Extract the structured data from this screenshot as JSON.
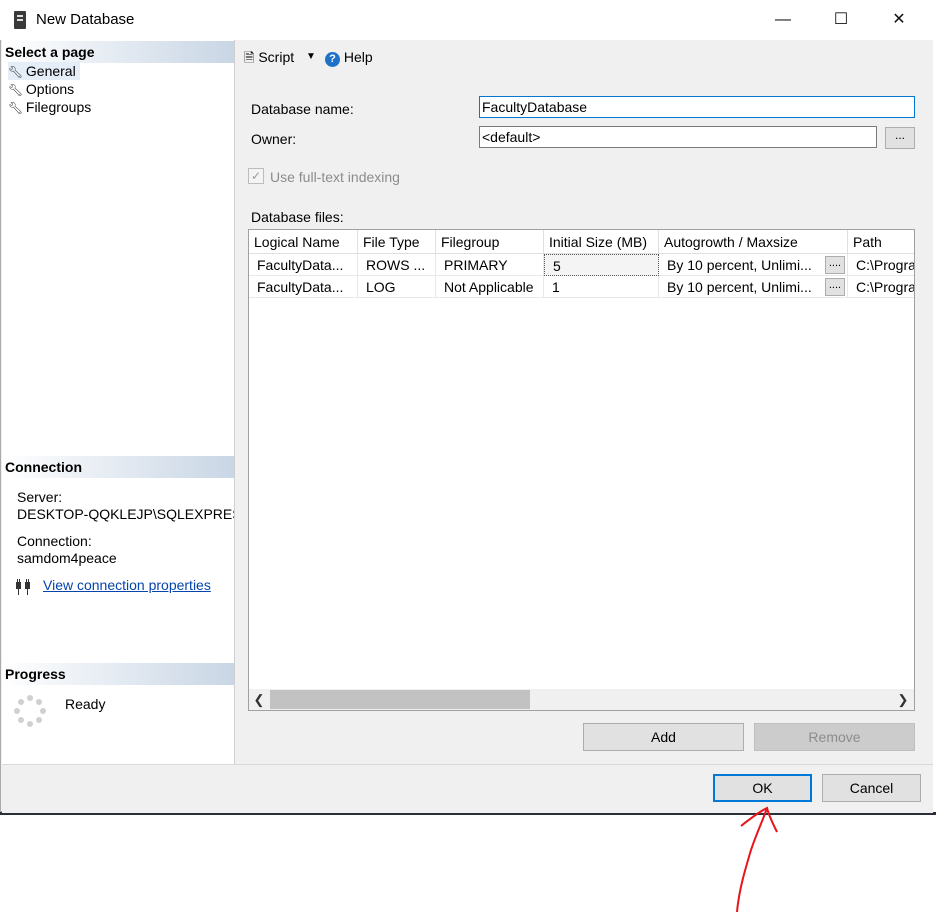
{
  "window": {
    "title": "New Database",
    "minimize_glyph": "—",
    "maximize_glyph": "☐",
    "close_glyph": "✕"
  },
  "left_pane": {
    "select_page_header": "Select a page",
    "pages": [
      {
        "label": "General",
        "icon": "wrench-icon",
        "selected": true
      },
      {
        "label": "Options",
        "icon": "wrench-icon",
        "selected": false
      },
      {
        "label": "Filegroups",
        "icon": "wrench-icon",
        "selected": false
      }
    ],
    "connection_header": "Connection",
    "server_label": "Server:",
    "server_value": "DESKTOP-QQKLEJP\\SQLEXPRESS",
    "connection_label": "Connection:",
    "connection_value": "samdom4peace",
    "view_connection_link": "View connection properties",
    "progress_header": "Progress",
    "progress_status": "Ready"
  },
  "toolbar": {
    "script_label": "Script",
    "help_label": "Help"
  },
  "general": {
    "database_name_label": "Database name:",
    "database_name_value": "FacultyDatabase",
    "owner_label": "Owner:",
    "owner_value": "<default>",
    "browse_glyph": "...",
    "fulltext_label": "Use full-text indexing",
    "fulltext_checked": true,
    "database_files_label": "Database files:"
  },
  "files_grid": {
    "columns": [
      "Logical Name",
      "File Type",
      "Filegroup",
      "Initial Size (MB)",
      "Autogrowth / Maxsize",
      "Path"
    ],
    "rows": [
      [
        "FacultyData...",
        "ROWS ...",
        "PRIMARY",
        "5",
        "By 10 percent, Unlimi...",
        "C:\\Progra"
      ],
      [
        "FacultyData...",
        "LOG",
        "Not Applicable",
        "1",
        "By 10 percent, Unlimi...",
        "C:\\Progra"
      ]
    ],
    "cell_button_glyph": "...."
  },
  "buttons": {
    "add": "Add",
    "remove": "Remove",
    "ok": "OK",
    "cancel": "Cancel"
  },
  "colors": {
    "accent": "#0078d7",
    "annotation_arrow": "#e8141c"
  }
}
